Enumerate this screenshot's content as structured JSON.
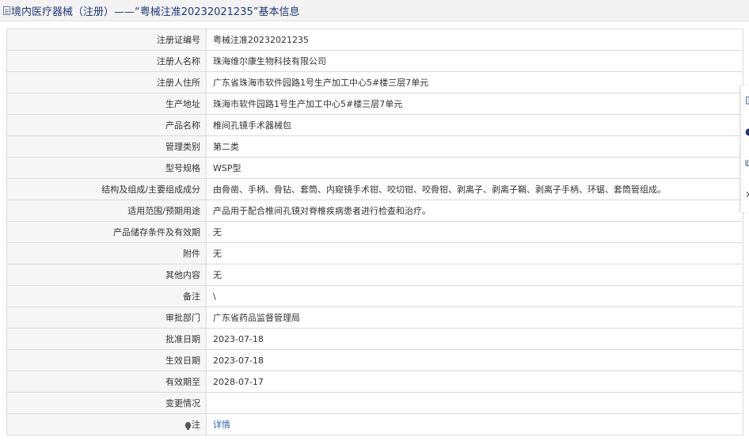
{
  "header": {
    "icon": "document-icon",
    "title": "境内医疗器械（注册）——“粤械注准20232021235”基本信息"
  },
  "rows": [
    {
      "label": "注册证编号",
      "value": "粤械注准20232021235"
    },
    {
      "label": "注册人名称",
      "value": "珠海维尔康生物科技有限公司"
    },
    {
      "label": "注册人住所",
      "value": "广东省珠海市软件园路1号生产加工中心5#楼三层7单元"
    },
    {
      "label": "生产地址",
      "value": "珠海市软件园路1号生产加工中心5#楼三层7单元"
    },
    {
      "label": "产品名称",
      "value": "椎间孔镜手术器械包"
    },
    {
      "label": "管理类别",
      "value": "第二类"
    },
    {
      "label": "型号规格",
      "value": "WSP型"
    },
    {
      "label": "结构及组成/主要组成成分",
      "value": "由骨凿、手柄、骨钻、套筒、内窥镜手术钳、咬切钳、咬骨钳、剥离子、剥离子鞘、剥离子手柄、环锯、套筒管组成。"
    },
    {
      "label": "适用范围/预期用途",
      "value": "产品用于配合椎间孔镜对脊椎疾病患者进行检查和治疗。"
    },
    {
      "label": "产品储存条件及有效期",
      "value": "无"
    },
    {
      "label": "附件",
      "value": "无"
    },
    {
      "label": "其他内容",
      "value": "无"
    },
    {
      "label": "备注",
      "value": "\\"
    },
    {
      "label": "审批部门",
      "value": "广东省药品监督管理局"
    },
    {
      "label": "批准日期",
      "value": "2023-07-18"
    },
    {
      "label": "生效日期",
      "value": "2023-07-18"
    },
    {
      "label": "有效期至",
      "value": "2028-07-17"
    },
    {
      "label": "变更情况",
      "value": ""
    }
  ],
  "note_row": {
    "icon": "lightbulb-icon",
    "label": "注",
    "link": "详情"
  },
  "side_panel": {
    "icons": [
      "document-icon",
      "circle-icon",
      "copy-icon",
      "close-icon"
    ]
  },
  "colors": {
    "title_text": "#1f3a7a",
    "link": "#2a63b8",
    "label_bg": "#f6f6f6",
    "border": "#dcdcdc"
  }
}
